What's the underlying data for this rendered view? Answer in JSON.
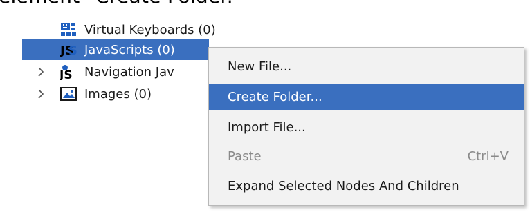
{
  "caption": "element \"Create Folder.\"",
  "tree": {
    "items": [
      {
        "label": "Virtual Keyboards (0)",
        "icon": "keyboard-grid-icon"
      },
      {
        "label": "JavaScripts (0)",
        "icon": "js-icon",
        "selected": true
      },
      {
        "label": "Navigation Jav",
        "icon": "navigation-js-icon",
        "collapsed": true
      },
      {
        "label": "Images (0)",
        "icon": "image-icon",
        "collapsed": true
      }
    ]
  },
  "context_menu": {
    "items": [
      {
        "label": "New File..."
      },
      {
        "label": "Create Folder...",
        "highlighted": true
      },
      {
        "label": "Import File..."
      },
      {
        "label": "Paste",
        "shortcut": "Ctrl+V",
        "disabled": true
      },
      {
        "label": "Expand Selected Nodes And Children"
      }
    ]
  },
  "colors": {
    "selection": "#3a6fbf",
    "menu_background": "#f2f2f2",
    "disabled_text": "#8a8a8a"
  }
}
